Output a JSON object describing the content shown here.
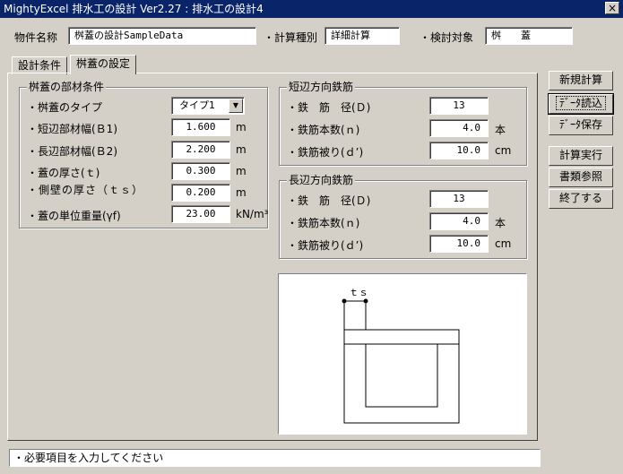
{
  "window": {
    "title": "MightyExcel 排水工の設計 Ver2.27 : 排水工の設計4",
    "close": "×"
  },
  "header": {
    "property_label": "物件名称",
    "property_value": "桝蓋の設計SampleData",
    "calc_type_label": "・計算種別",
    "calc_type_value": "詳細計算",
    "target_label": "・検討対象",
    "target_value": "桝　　蓋"
  },
  "tabs": [
    {
      "label": "設計条件"
    },
    {
      "label": "桝蓋の設定"
    }
  ],
  "material": {
    "title": "桝蓋の部材条件",
    "rows": [
      {
        "label": "・桝蓋のタイプ",
        "value": "タイプ1",
        "unit": ""
      },
      {
        "label": "・短辺部材幅(Ｂ1)",
        "value": "1.600",
        "unit": "m"
      },
      {
        "label": "・長辺部材幅(Ｂ2)",
        "value": "2.200",
        "unit": "m"
      },
      {
        "label": "・蓋の厚さ(ｔ)",
        "value": "0.300",
        "unit": "m"
      },
      {
        "label": "・側壁の厚さ（ｔｓ）",
        "value": "0.200",
        "unit": "m"
      },
      {
        "label": "・蓋の単位重量(γf)",
        "value": "23.00",
        "unit": "kN/m³"
      }
    ]
  },
  "short_rebar": {
    "title": "短辺方向鉄筋",
    "rows": [
      {
        "label": "・鉄　筋　径(Ｄ)",
        "value": "13",
        "unit": ""
      },
      {
        "label": "・鉄筋本数(ｎ)",
        "value": "4.0",
        "unit": "本"
      },
      {
        "label": "・鉄筋被り(ｄ’)",
        "value": "10.0",
        "unit": "cm"
      }
    ]
  },
  "long_rebar": {
    "title": "長辺方向鉄筋",
    "rows": [
      {
        "label": "・鉄　筋　径(Ｄ)",
        "value": "13",
        "unit": ""
      },
      {
        "label": "・鉄筋本数(ｎ)",
        "value": "4.0",
        "unit": "本"
      },
      {
        "label": "・鉄筋被り(ｄ’)",
        "value": "10.0",
        "unit": "cm"
      }
    ]
  },
  "diagram": {
    "dim_label": "ｔｓ"
  },
  "buttons": {
    "new_calc": "新規計算",
    "load_data": "ﾃﾞｰﾀ読込",
    "save_data": "ﾃﾞｰﾀ保存",
    "run_calc": "計算実行",
    "documents": "書類参照",
    "exit": "終了する"
  },
  "status": {
    "message": "・必要項目を入力してください"
  },
  "colors": {
    "titlebar": "#0a246a",
    "face": "#d4d0c8"
  },
  "icons": {
    "select_arrow": "chevron-down-icon"
  }
}
